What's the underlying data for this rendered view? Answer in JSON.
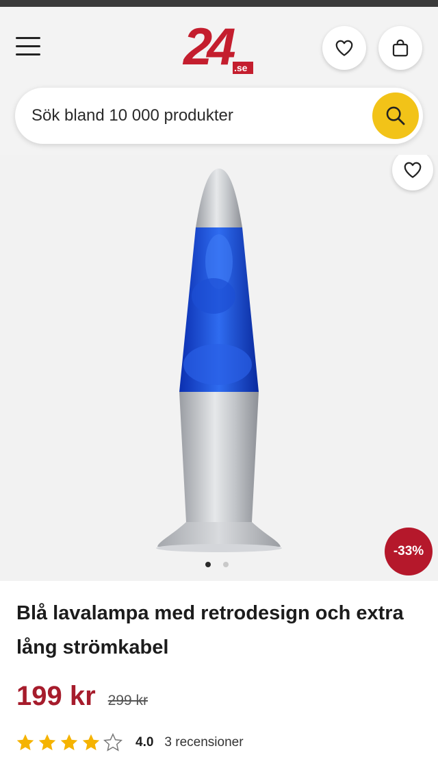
{
  "header": {
    "logo_text": "24",
    "logo_suffix": ".se"
  },
  "search": {
    "placeholder": "Sök bland 10 000 produkter"
  },
  "product": {
    "title": "Blå lavalampa med retrodesign och extra lång strömkabel",
    "price": "199 kr",
    "old_price": "299 kr",
    "discount_badge": "-33%",
    "rating_value": "4.0",
    "rating": 4.0,
    "rating_max": 5,
    "review_count": "3 recensioner",
    "image_count": 2,
    "active_image": 1
  },
  "colors": {
    "brand_red": "#c41e2e",
    "price_red": "#a61c2c",
    "search_button": "#f2c318",
    "star": "#f5b301"
  },
  "icons": {
    "menu": "hamburger-icon",
    "wishlist": "heart-icon",
    "cart": "shopping-bag-icon",
    "search": "magnifier-icon"
  }
}
